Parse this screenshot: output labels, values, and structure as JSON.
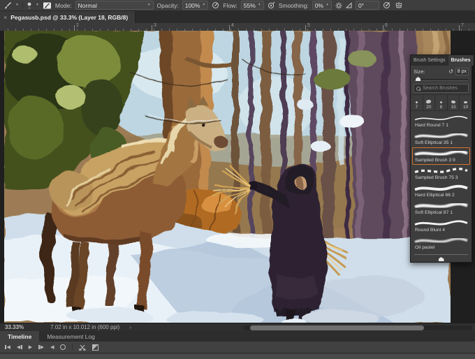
{
  "options_bar": {
    "mode_label": "Mode:",
    "mode_value": "Normal",
    "opacity_label": "Opacity:",
    "opacity_value": "100%",
    "flow_label": "Flow:",
    "flow_value": "55%",
    "smoothing_label": "Smoothing:",
    "smoothing_value": "0%",
    "angle_value": "0°"
  },
  "document_tab": {
    "close_label": "×",
    "title": "Pegasusb.psd @ 33.3% (Layer 18, RGB/8)"
  },
  "ruler": {
    "numbers": [
      "2",
      "3",
      "4",
      "5",
      "6",
      "7"
    ]
  },
  "brushes_panel": {
    "tab_settings": "Brush Settings",
    "tab_brushes": "Brushes",
    "size_label": "Size:",
    "size_value": "8 px",
    "search_placeholder": "Search Brushes",
    "recent_sizes": [
      "7",
      "20",
      "8",
      "15",
      "10"
    ],
    "brushes": [
      {
        "name": "Hard Round 7 1"
      },
      {
        "name": "Soft Elliptical 35 1"
      },
      {
        "name": "Sampled Brush 3 9"
      },
      {
        "name": "Sampled Brush 75 3"
      },
      {
        "name": "Hard Elliptical 66 2"
      },
      {
        "name": "Soft Elliptical 87 1"
      },
      {
        "name": "Round Blunt 4"
      },
      {
        "name": "Oil pastel"
      }
    ],
    "accent_color": "#d8732a"
  },
  "status_bar": {
    "zoom_value": "33.33%",
    "doc_info": "7.02 in x 10.012 in (600 ppi)"
  },
  "timeline": {
    "tab_timeline": "Timeline",
    "tab_measurement": "Measurement Log"
  }
}
